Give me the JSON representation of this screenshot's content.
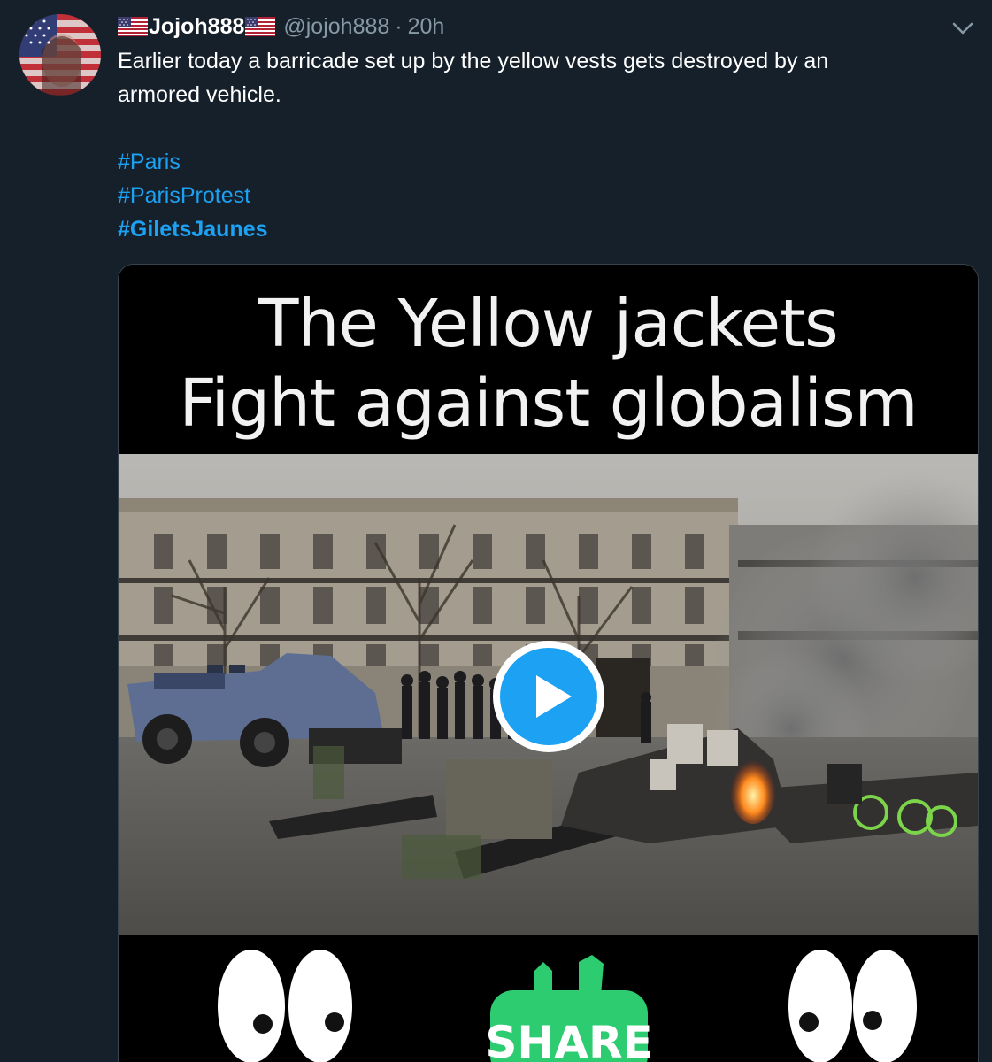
{
  "tweet": {
    "display_name": "Jojoh888",
    "handle": "@jojoh888",
    "separator": "·",
    "time": "20h",
    "text_line1": "Earlier today a barricade set up by the yellow vests gets destroyed by an",
    "text_line2": "armored vehicle.",
    "hashtags": [
      "#Paris",
      "#ParisProtest",
      "#GiletsJaunes"
    ]
  },
  "media": {
    "caption_line1": "The Yellow jackets",
    "caption_line2": "Fight against globalism",
    "share_label": "SHARE"
  },
  "icons": {
    "flag": "us-flag-emoji",
    "menu": "chevron-down-icon",
    "play": "play-icon"
  },
  "colors": {
    "background": "#15202b",
    "link": "#1da1f2",
    "secondary_text": "#8899a6",
    "play_button": "#1da1f2",
    "share_badge": "#2ecc71"
  }
}
